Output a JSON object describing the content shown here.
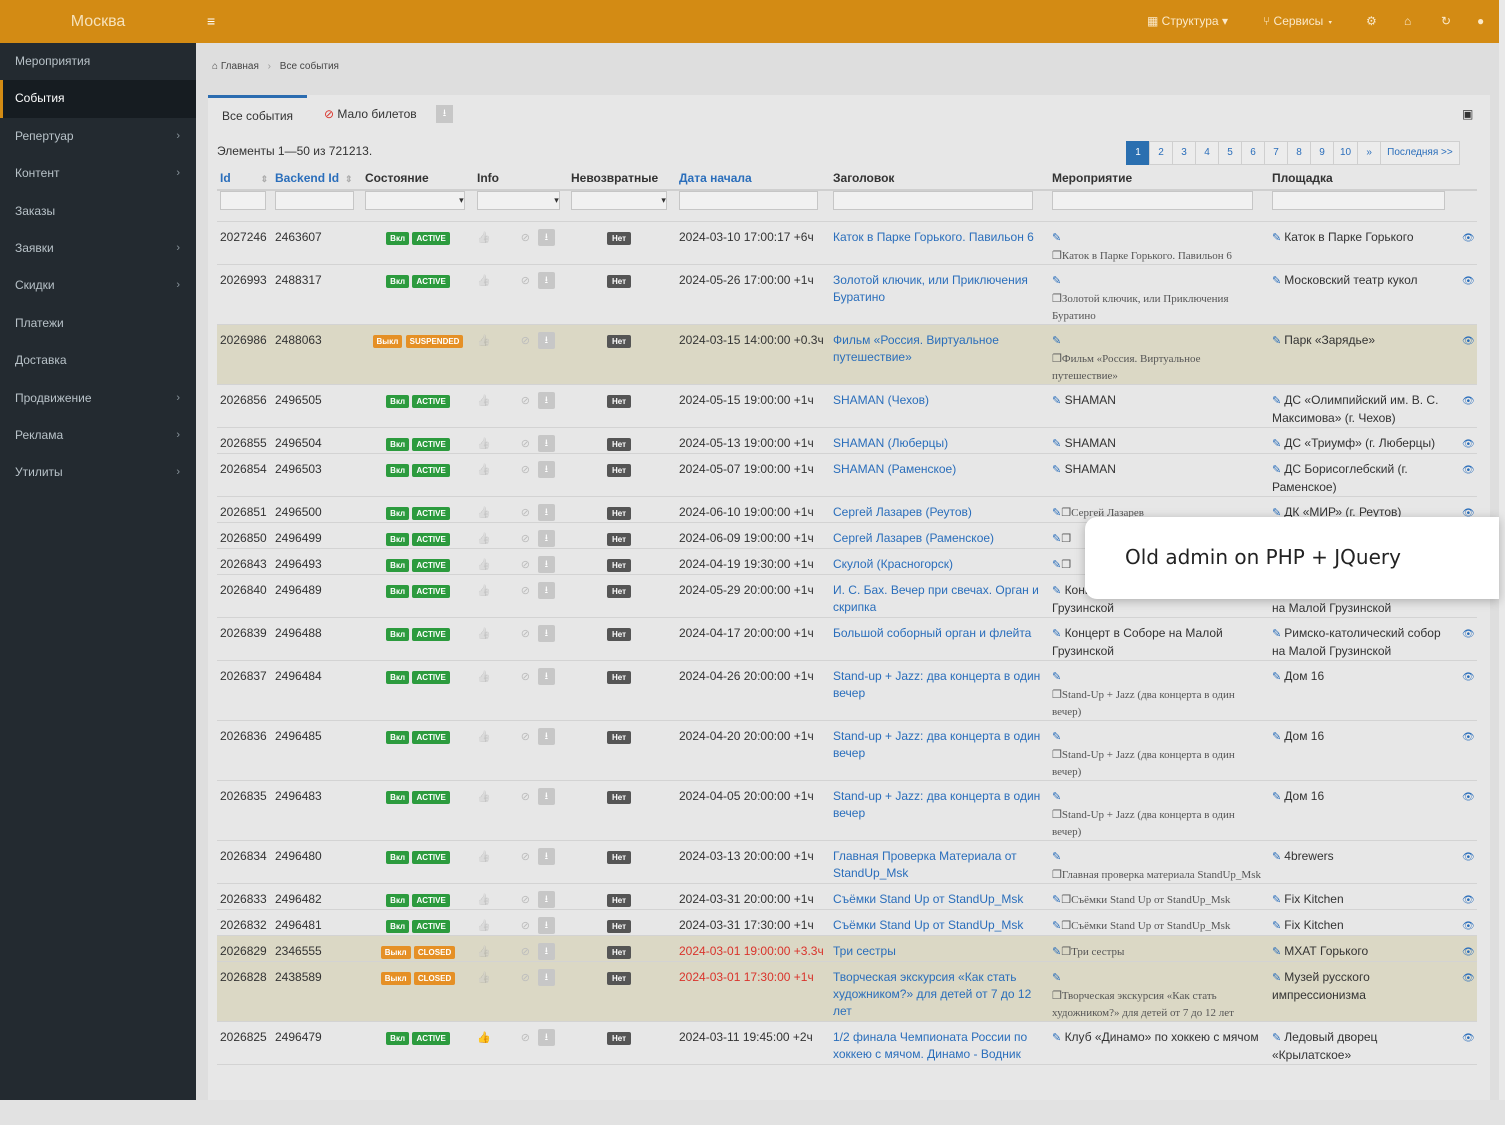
{
  "app": {
    "brand": "Москва",
    "nav": [
      {
        "icon": "grid-icon",
        "label": "Структура"
      },
      {
        "icon": "fork-icon",
        "label": "Сервисы"
      }
    ],
    "icons": [
      "cogs-icon",
      "home-icon",
      "refresh-icon",
      "user-icon"
    ]
  },
  "sidebar": {
    "items": [
      {
        "label": "Мероприятия",
        "chev": false
      },
      {
        "label": "События",
        "chev": false,
        "active": true
      },
      {
        "label": "Репертуар",
        "chev": true
      },
      {
        "label": "Контент",
        "chev": true
      },
      {
        "label": "Заказы",
        "chev": false
      },
      {
        "label": "Заявки",
        "chev": true
      },
      {
        "label": "Скидки",
        "chev": true
      },
      {
        "label": "Платежи",
        "chev": false
      },
      {
        "label": "Доставка",
        "chev": false
      },
      {
        "label": "Продвижение",
        "chev": true
      },
      {
        "label": "Реклама",
        "chev": true
      },
      {
        "label": "Утилиты",
        "chev": true
      }
    ]
  },
  "breadcrumb": {
    "home": "Главная",
    "current": "Все события"
  },
  "tabs": {
    "all": "Все события",
    "few": "Мало билетов"
  },
  "summary": "Элементы 1—50 из 721213.",
  "pager": [
    "1",
    "2",
    "3",
    "4",
    "5",
    "6",
    "7",
    "8",
    "9",
    "10",
    "»",
    "Последняя >>"
  ],
  "columns": [
    "Id",
    "Backend Id",
    "Состояние",
    "Info",
    "Невозвратные",
    "Дата начала",
    "Заголовок",
    "Мероприятие",
    "Площадка"
  ],
  "rows": [
    {
      "id": "2027246",
      "bid": "2463607",
      "s1": "Вкл",
      "s2": "ACTIVE",
      "date": "2024-03-10 17:00:17 +6ч",
      "title": "Каток в Парке Горького. Павильон 6",
      "ev": "Каток в Парке Горького. Павильон 6",
      "evSerif": true,
      "venue": "Каток в Парке Горького"
    },
    {
      "id": "2026993",
      "bid": "2488317",
      "s1": "Вкл",
      "s2": "ACTIVE",
      "date": "2024-05-26 17:00:00 +1ч",
      "title": "Золотой ключик, или Приключения Буратино",
      "ev": "Золотой ключик, или Приключения Буратино",
      "evSerif": true,
      "venue": "Московский театр кукол"
    },
    {
      "id": "2026986",
      "bid": "2488063",
      "s1": "Выкл",
      "s2": "SUSPENDED",
      "warn": true,
      "date": "2024-03-15 14:00:00 +0.3ч",
      "title": "Фильм «Россия. Виртуальное путешествие»",
      "ev": "Фильм «Россия. Виртуальное путешествие»",
      "evSerif": true,
      "venue": "Парк «Зарядье»"
    },
    {
      "id": "2026856",
      "bid": "2496505",
      "s1": "Вкл",
      "s2": "ACTIVE",
      "date": "2024-05-15 19:00:00 +1ч",
      "title": "SHAMAN (Чехов)",
      "ev": "SHAMAN",
      "venue": "ДС «Олимпийский им. В. С. Максимова» (г. Чехов)"
    },
    {
      "id": "2026855",
      "bid": "2496504",
      "s1": "Вкл",
      "s2": "ACTIVE",
      "date": "2024-05-13 19:00:00 +1ч",
      "title": "SHAMAN (Люберцы)",
      "ev": "SHAMAN",
      "venue": "ДС «Триумф» (г. Люберцы)"
    },
    {
      "id": "2026854",
      "bid": "2496503",
      "s1": "Вкл",
      "s2": "ACTIVE",
      "date": "2024-05-07 19:00:00 +1ч",
      "title": "SHAMAN (Раменское)",
      "ev": "SHAMAN",
      "venue": "ДС Борисоглебский (г. Раменское)"
    },
    {
      "id": "2026851",
      "bid": "2496500",
      "s1": "Вкл",
      "s2": "ACTIVE",
      "date": "2024-06-10 19:00:00 +1ч",
      "title": "Сергей Лазарев (Реутов)",
      "ev": "Сергей Лазарев",
      "evSerif": true,
      "inline": true,
      "venue": "ДК «МИР» (г. Реутов)"
    },
    {
      "id": "2026850",
      "bid": "2496499",
      "s1": "Вкл",
      "s2": "ACTIVE",
      "date": "2024-06-09 19:00:00 +1ч",
      "title": "Сергей Лазарев (Раменское)",
      "ev": "",
      "inline": true,
      "venue": ""
    },
    {
      "id": "2026843",
      "bid": "2496493",
      "s1": "Вкл",
      "s2": "ACTIVE",
      "date": "2024-04-19 19:30:00 +1ч",
      "title": "Скулой (Красногорск)",
      "ev": "",
      "inline": true,
      "venue": ""
    },
    {
      "id": "2026840",
      "bid": "2496489",
      "s1": "Вкл",
      "s2": "ACTIVE",
      "date": "2024-05-29 20:00:00 +1ч",
      "title": "И. С. Бах. Вечер при свечах. Орган и скрипка",
      "ev": "Концерт в Соборе на Малой Грузинской",
      "venue": "Римско-католический собор на Малой Грузинской"
    },
    {
      "id": "2026839",
      "bid": "2496488",
      "s1": "Вкл",
      "s2": "ACTIVE",
      "date": "2024-04-17 20:00:00 +1ч",
      "title": "Большой соборный орган и флейта",
      "ev": "Концерт в Соборе на Малой Грузинской",
      "venue": "Римско-католический собор на Малой Грузинской"
    },
    {
      "id": "2026837",
      "bid": "2496484",
      "s1": "Вкл",
      "s2": "ACTIVE",
      "date": "2024-04-26 20:00:00 +1ч",
      "title": "Stand-up + Jazz: два концерта в один вечер",
      "ev": "Stand-Up + Jazz (два концерта в один вечер)",
      "evSerif": true,
      "venue": "Дом 16"
    },
    {
      "id": "2026836",
      "bid": "2496485",
      "s1": "Вкл",
      "s2": "ACTIVE",
      "date": "2024-04-20 20:00:00 +1ч",
      "title": "Stand-up + Jazz: два концерта в один вечер",
      "ev": "Stand-Up + Jazz (два концерта в один вечер)",
      "evSerif": true,
      "venue": "Дом 16"
    },
    {
      "id": "2026835",
      "bid": "2496483",
      "s1": "Вкл",
      "s2": "ACTIVE",
      "date": "2024-04-05 20:00:00 +1ч",
      "title": "Stand-up + Jazz: два концерта в один вечер",
      "ev": "Stand-Up + Jazz (два концерта в один вечер)",
      "evSerif": true,
      "venue": "Дом 16"
    },
    {
      "id": "2026834",
      "bid": "2496480",
      "s1": "Вкл",
      "s2": "ACTIVE",
      "date": "2024-03-13 20:00:00 +1ч",
      "title": "Главная Проверка Материала от StandUp_Msk",
      "ev": "Главная проверка материала StandUp_Msk",
      "evSerif": true,
      "venue": "4brewers"
    },
    {
      "id": "2026833",
      "bid": "2496482",
      "s1": "Вкл",
      "s2": "ACTIVE",
      "date": "2024-03-31 20:00:00 +1ч",
      "title": "Съёмки Stand Up от StandUp_Msk",
      "ev": "Съёмки Stand Up от StandUp_Msk",
      "evSerif": true,
      "inline": true,
      "venue": "Fix Kitchen"
    },
    {
      "id": "2026832",
      "bid": "2496481",
      "s1": "Вкл",
      "s2": "ACTIVE",
      "date": "2024-03-31 17:30:00 +1ч",
      "title": "Съёмки Stand Up от StandUp_Msk",
      "ev": "Съёмки Stand Up от StandUp_Msk",
      "evSerif": true,
      "inline": true,
      "venue": "Fix Kitchen"
    },
    {
      "id": "2026829",
      "bid": "2346555",
      "s1": "Выкл",
      "s2": "CLOSED",
      "warn": true,
      "past": true,
      "date": "2024-03-01 19:00:00 +3.3ч",
      "title": "Три сестры",
      "ev": "Три сестры",
      "evSerif": true,
      "inline": true,
      "venue": "МХАТ Горького"
    },
    {
      "id": "2026828",
      "bid": "2438589",
      "s1": "Выкл",
      "s2": "CLOSED",
      "warn": true,
      "past": true,
      "date": "2024-03-01 17:30:00 +1ч",
      "title": "Творческая экскурсия «Как стать художником?» для детей от 7 до 12 лет",
      "ev": "Творческая экскурсия «Как стать художником?» для детей от 7 до 12 лет",
      "evSerif": true,
      "venue": "Музей русского импрессионизма"
    },
    {
      "id": "2026825",
      "bid": "2496479",
      "s1": "Вкл",
      "s2": "ACTIVE",
      "thumb": true,
      "date": "2024-03-11 19:45:00 +2ч",
      "title": "1/2 финала Чемпионата России по хоккею с мячом. Динамо - Водник",
      "ev": "Клуб «Динамо» по хоккею с мячом",
      "venue": "Ледовый дворец «Крылатское»"
    }
  ],
  "callout": "Old admin on PHP + JQuery"
}
